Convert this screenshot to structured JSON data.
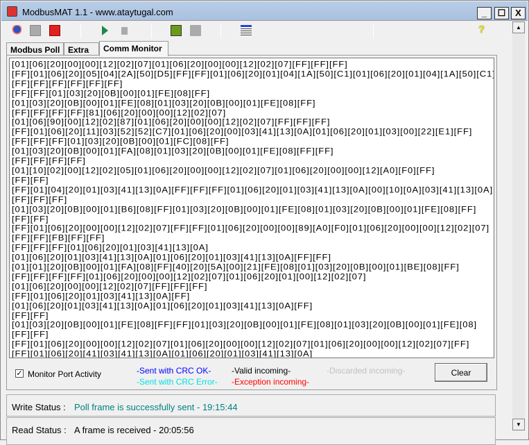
{
  "window": {
    "title": "ModbusMAT 1.1  -  www.ataytugal.com",
    "minimize": "_",
    "maximize": "☐",
    "close": "X"
  },
  "toolbar": {
    "icons": [
      "connect-icon",
      "reconnect-icon",
      "disconnect-icon",
      "play-icon",
      "stop-icon",
      "search-icon",
      "blank-icon",
      "list-icon",
      "help-icon"
    ],
    "help": "?"
  },
  "tabs": [
    {
      "label": "Modbus Poll"
    },
    {
      "label": "Extra"
    },
    {
      "label": "Comm Monitor",
      "active": true
    }
  ],
  "log": {
    "lines": [
      "[01][06][20][00][00][12][02][07][01][06][20][00][00][12][02][07][FF][FF][FF]",
      "[FF][01][06][20][05][04][2A][50][D5][FF][FF][01][06][20][01][04][1A][50][C1][01][06][20][01][04][1A][50][C1]",
      "[FF][FF][FF][FF][FF][FF]",
      "[FF][FF][01][03][20][0B][00][01][FE][08][FF]",
      "[01][03][20][0B][00][01][FE][08][01][03][20][0B][00][01][FE][08][FF]",
      "[FF][FF][FF][FF][81][06][20][00][00][12][02][07]",
      "[01][06][90][00][12][02][87][01][06][20][00][00][12][02][07][FF][FF][FF]",
      "[FF][01][06][20][11][03][52][52][C7][01][06][20][00][03][41][13][0A][01][06][20][01][03][00][22][E1][FF]",
      "[FF][FF][FF][01][03][20][0B][00][01][FC][08][FF]",
      "[01][03][20][0B][00][01][FA][08][01][03][20][0B][00][01][FE][08][FF][FF]",
      "[FF][FF][FF][FF]",
      "[01][10][02][00][12][02][05][01][06][20][00][00][12][02][07][01][06][20][00][00][12][A0][F0][FF]",
      "[FF][FF]",
      "[FF][01][04][20][01][03][41][13][0A][FF][FF][FF][01][06][20][01][03][41][13][0A][00][10][0A][03][41][13][0A][FF]",
      "[FF][FF][FF]",
      "[01][03][20][0B][00][01][B6][08][FF][01][03][20][0B][00][01][FE][08][01][03][20][0B][00][01][FE][08][FF]",
      "[FF][FF]",
      "[FF][01][06][20][00][00][12][02][07][FF][FF][01][06][20][00][00][89][A0][F0][01][06][20][00][00][12][02][07]",
      "[FF][FF][FB][FF][FF]",
      "[FF][FF][FF][01][06][20][01][03][41][13][0A]",
      "[01][06][20][01][03][41][13][0A][01][06][20][01][03][41][13][0A][FF][FF]",
      "[01][01][20][0B][00][01][FA][08][FF][40][20][5A][00][21][FE][08][01][03][20][0B][00][01][BE][08][FF]",
      "[FF][FF][FF][FF][01][06][20][00][00][12][02][07][01][06][20][01][00][12][02][07]",
      "[01][06][20][00][00][12][02][07][FF][FF][FF]",
      "[FF][01][06][20][01][03][41][13][0A][FF]",
      "[01][06][20][01][03][41][13][0A][01][06][20][01][03][41][13][0A][FF]",
      "[FF][FF]",
      "[01][03][20][0B][00][01][FE][08][FF][FF][01][03][20][0B][00][01][FE][08][01][03][20][0B][00][01][FE][08]",
      "[FF][FF]",
      "[FF][01][06][20][00][00][12][02][07][01][06][20][00][00][12][02][07][01][06][20][00][00][12][02][07][FF]",
      "[FF][01][06][20][41][03][41][13][0A][01][06][20][01][03][41][13][0A]"
    ]
  },
  "controls": {
    "monitor_label": "Monitor Port Activity",
    "monitor_checked": true,
    "check": "✓",
    "clear": "Clear"
  },
  "legend": {
    "sent_ok": "-Sent with CRC OK-",
    "sent_err": "-Sent with CRC Error-",
    "valid": "-Valid incoming-",
    "exception": "-Exception incoming-",
    "discarded": "-Discarded incoming-"
  },
  "colors": {
    "sent_ok": "#0000ff",
    "sent_err": "#00ffff",
    "valid": "#000000",
    "exception": "#ff0000",
    "discarded": "#c0c0c0",
    "status": "#008080"
  },
  "status": {
    "write_label": "Write Status :",
    "write_value": "Poll frame is successfully sent - 19:15:44",
    "read_label": "Read Status :",
    "read_value": "A frame is received - 20:05:56"
  },
  "scroll": {
    "up": "▲",
    "down": "▼"
  }
}
